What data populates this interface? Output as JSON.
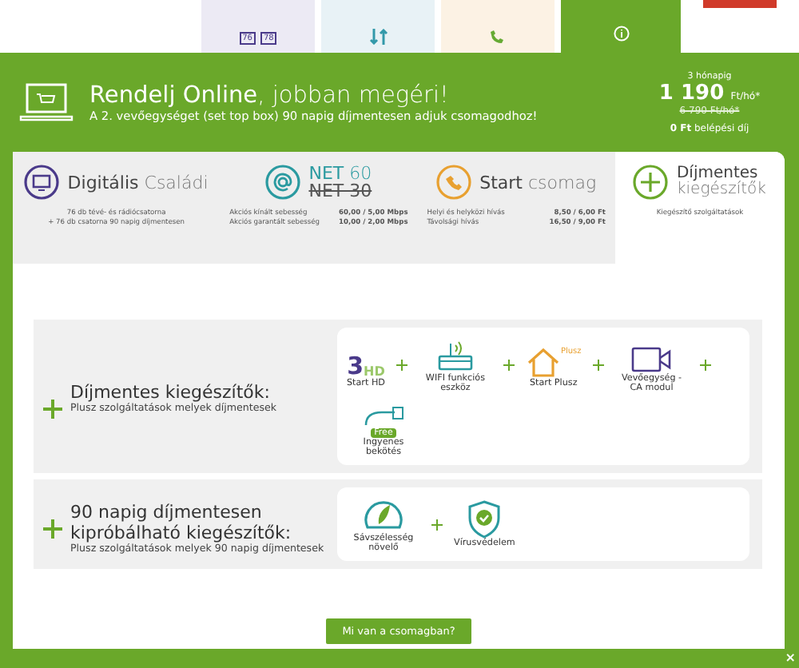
{
  "top_tiles": [
    {
      "kind": "tv",
      "texts": [
        "76",
        "78"
      ]
    },
    {
      "kind": "net"
    },
    {
      "kind": "phone"
    }
  ],
  "promo": {
    "title_bold": "Rendelj Online",
    "title_rest": ", jobban megéri!",
    "subtitle": "A 2. vevőegységet (set top box) 90 napig díjmentesen adjuk csomagodhoz!",
    "period": "3 hónapig",
    "price": "1 190",
    "price_unit": "Ft/hó*",
    "old_price": "6 790 Ft/hó*",
    "fee_bold": "0 Ft",
    "fee_rest": "belépési díj"
  },
  "tabs": [
    {
      "kind": "tv",
      "title": "Digitális",
      "subtitle": "Családi",
      "selected": false,
      "lines": [
        "76 db tévé- és rádiócsatorna",
        "+ 76 db csatorna 90 napig díjmentesen"
      ]
    },
    {
      "kind": "net",
      "title": "NET",
      "subtitle": "60",
      "old_title": "NET 30",
      "selected": false,
      "rows": [
        [
          "Akciós kínált sebesség",
          "60,00 / 5,00 Mbps"
        ],
        [
          "Akciós garantált sebesség",
          "10,00 / 2,00 Mbps"
        ]
      ]
    },
    {
      "kind": "phone",
      "title": "Start",
      "subtitle": "csomag",
      "selected": false,
      "rows": [
        [
          "Helyi és helyközi hívás",
          "8,50 / 6,00 Ft"
        ],
        [
          "Távolsági hívás",
          "16,50 / 9,00 Ft"
        ]
      ]
    },
    {
      "kind": "plus",
      "title": "Díjmentes",
      "subtitle": "kiegészítők",
      "selected": true,
      "lines": [
        "Kiegészítő szolgáltatások"
      ]
    }
  ],
  "sections": [
    {
      "title": "Díjmentes kiegészítők:",
      "subtitle": "Plusz szolgáltatások melyek díjmentesek",
      "items": [
        {
          "kind": "hd",
          "label": "Start HD",
          "badge": "3",
          "badge_2": "HD"
        },
        {
          "kind": "router",
          "label": "WIFI funkciós eszköz"
        },
        {
          "kind": "house",
          "label": "Start Plusz",
          "badge": "Plusz"
        },
        {
          "kind": "camera",
          "label": "Vevőegység - CA modul"
        },
        {
          "kind": "cable",
          "label": "Ingyenes bekötés",
          "badge": "Free"
        }
      ]
    },
    {
      "title": "90 napig díjmentesen kipróbálható kiegészítők:",
      "subtitle": "Plusz szolgáltatások melyek 90 napig díjmentesek",
      "items": [
        {
          "kind": "gauge",
          "label": "Sávszélesség növelő"
        },
        {
          "kind": "shield",
          "label": "Vírusvédelem"
        }
      ]
    }
  ],
  "button": "Mi van a csomagban?",
  "close": "×"
}
